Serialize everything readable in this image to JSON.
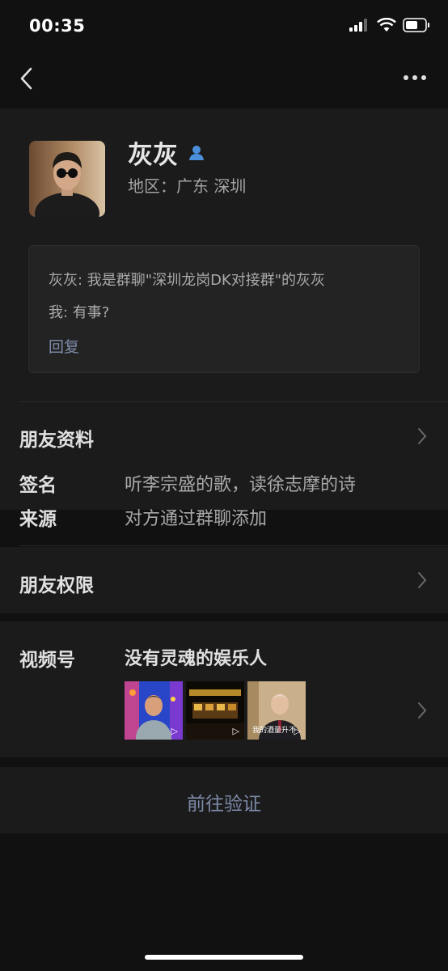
{
  "status_bar": {
    "time": "00:35"
  },
  "profile": {
    "name": "灰灰",
    "region": "地区：广东 深圳"
  },
  "greeting": {
    "line1": "灰灰: 我是群聊\"深圳龙岗DK对接群\"的灰灰",
    "line2": "我: 有事?",
    "reply_label": "回复"
  },
  "friend_info": {
    "title": "朋友资料"
  },
  "signature": {
    "label": "签名",
    "value": "听李宗盛的歌，读徐志摩的诗"
  },
  "source": {
    "label": "来源",
    "value": "对方通过群聊添加"
  },
  "permissions": {
    "title": "朋友权限"
  },
  "channels": {
    "label": "视频号",
    "title": "没有灵魂的娱乐人",
    "thumb3_caption": "我的酒量升不"
  },
  "verify": {
    "label": "前往验证"
  },
  "colors": {
    "background": "#111111",
    "card": "#1b1b1b",
    "link": "#7d8aa8"
  }
}
